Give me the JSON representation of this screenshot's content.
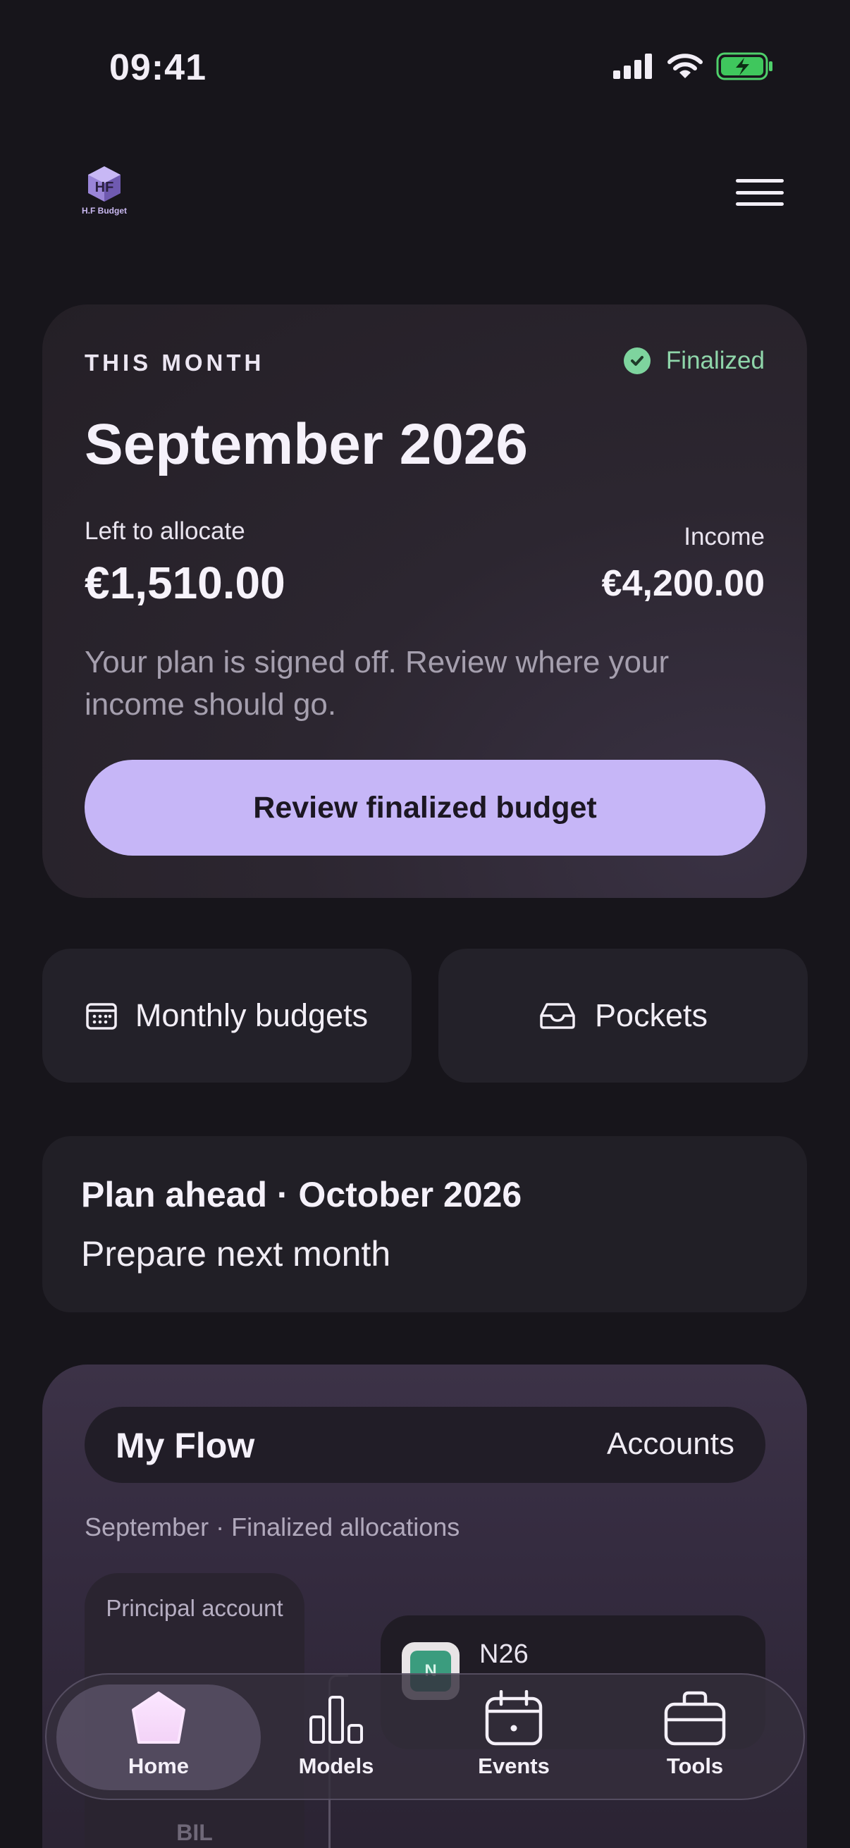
{
  "status_bar": {
    "time": "09:41"
  },
  "header": {
    "logo_text": "H.F Budget"
  },
  "month_card": {
    "label": "THIS MONTH",
    "status": "Finalized",
    "title": "September 2026",
    "left_label": "Left to allocate",
    "left_value": "€1,510.00",
    "income_label": "Income",
    "income_value": "€4,200.00",
    "description": "Your plan is signed off. Review where your income should go.",
    "cta_label": "Review finalized budget",
    "status_color": "#8fd6aa",
    "accent_color": "#c6b6f7"
  },
  "quick_actions": [
    {
      "label": "Monthly budgets",
      "icon": "calendar-icon"
    },
    {
      "label": "Pockets",
      "icon": "inbox-tray-icon"
    }
  ],
  "plan_ahead": {
    "title": "Plan ahead · October 2026",
    "subtitle": "Prepare next month"
  },
  "flow": {
    "title": "My Flow",
    "accounts_label": "Accounts",
    "subtitle": "September · Finalized allocations",
    "principal_label": "Principal account",
    "principal_bank": "BIL",
    "account_name": "N26",
    "account_logo": "N"
  },
  "bottom_nav": [
    {
      "label": "Home",
      "icon": "home-icon",
      "active": true
    },
    {
      "label": "Models",
      "icon": "bar-chart-icon",
      "active": false
    },
    {
      "label": "Events",
      "icon": "calendar-icon",
      "active": false
    },
    {
      "label": "Tools",
      "icon": "toolbox-icon",
      "active": false
    }
  ]
}
